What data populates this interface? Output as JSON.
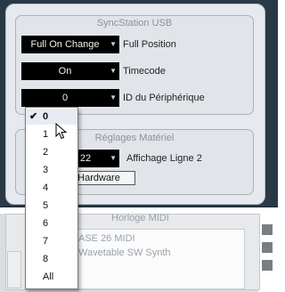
{
  "sync_panel": {
    "title": "SyncStation USB",
    "full_position": {
      "value": "Full On Change",
      "label": "Full Position"
    },
    "timecode": {
      "value": "On",
      "label": "Timecode"
    },
    "device_id": {
      "value": "0",
      "label": "ID du Périphérique"
    }
  },
  "hardware_panel": {
    "title": "Réglages Matériel",
    "display_line2": {
      "value": "22",
      "label": "Affichage Ligne 2"
    },
    "hardware_button": "Hardware"
  },
  "background_window": {
    "section_title": "Horloge MIDI",
    "list": [
      "ASE 26 MIDI",
      "Wavetable SW Synth"
    ]
  },
  "device_id_menu": {
    "selected": "0",
    "options": [
      "0",
      "1",
      "2",
      "3",
      "4",
      "5",
      "6",
      "7",
      "8",
      "All"
    ]
  }
}
